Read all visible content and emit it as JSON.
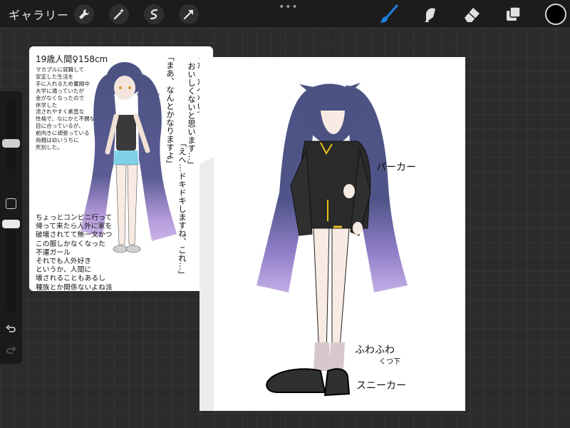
{
  "toolbar": {
    "gallery_label": "ギャラリー",
    "left_tools": [
      {
        "icon": "wrench-icon",
        "name": "actions"
      },
      {
        "icon": "magic-wand-icon",
        "name": "adjustments"
      },
      {
        "icon": "selection-icon",
        "name": "selection"
      },
      {
        "icon": "arrow-cursor-icon",
        "name": "transform"
      }
    ],
    "more_label": "•••",
    "right_tools": [
      {
        "icon": "brush-icon",
        "name": "brush",
        "active": true
      },
      {
        "icon": "smudge-icon",
        "name": "smudge"
      },
      {
        "icon": "eraser-icon",
        "name": "eraser"
      },
      {
        "icon": "layers-icon",
        "name": "layers"
      }
    ],
    "current_color": "#000000",
    "accent_color": "#1f7fdc"
  },
  "sidebar": {
    "brush_size_fraction": 0.4,
    "opacity_fraction": 1.0
  },
  "reference": {
    "title": "19歳人間♀158cm",
    "description_lines": [
      "マカプルに就職して",
      "安定した生活を",
      "手に入れるため奮闘中",
      "大学に通っていたが",
      "金がなくなったので",
      "休学した",
      "流されやすく素直な",
      "性格で、なにかと不憫な",
      "目に合っているが、",
      "前向きに頑張っている",
      "両親は幼いうちに",
      "死別した。"
    ],
    "bottom_lines": [
      "ちょっとコンビニ行って",
      "帰って来たら人外に家を",
      "破壊されてて無一文かつ",
      "この服しかなくなった",
      "不運ガール",
      "それでも人外好き",
      "というか、人間に",
      "壊されることもあるし",
      "種族とか関係ないよね派"
    ],
    "quote_1": "「まあ、なんとかなりますよ」",
    "quote_2": "「た、たべないで！",
    "quote_2b": "おいしくないと思います…」",
    "quote_3": "「えへ…ドキドキしますね、これ…」"
  },
  "canvas": {
    "notes": {
      "parka": "パーカー",
      "socks_1": "ふわふわ",
      "socks_2": "くつ下",
      "sneakers": "スニーカー"
    },
    "hair_top_color": "#4c5383",
    "hair_tip_color": "#b298d8",
    "parka_color": "#2a2a2a",
    "accent_yellow": "#e8c11c"
  }
}
